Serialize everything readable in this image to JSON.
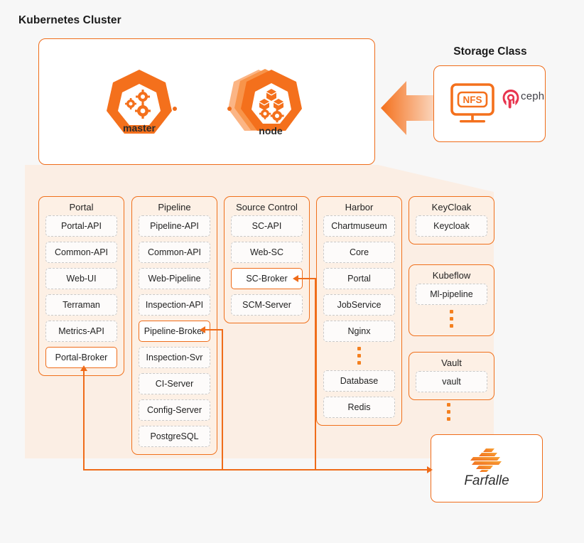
{
  "colors": {
    "accent": "#ef6c1a",
    "accent_light": "#fdf0e5",
    "panel_bg": "#fbeee4",
    "canvas_bg": "#f7f7f7",
    "ceph_pink": "#e8344e",
    "dashed_border": "#c9c9c9"
  },
  "cluster": {
    "title": "Kubernetes Cluster",
    "nodes": [
      {
        "label": "master",
        "icon": "kubernetes-master-icon"
      },
      {
        "label": "node",
        "icon": "kubernetes-node-icon"
      }
    ]
  },
  "storage_class": {
    "title": "Storage Class",
    "items": [
      {
        "label": "NFS",
        "icon": "nfs-monitor-icon"
      },
      {
        "label": "ceph",
        "icon": "ceph-logo-icon"
      }
    ],
    "arrow_icon": "left-arrow-icon"
  },
  "groups": [
    {
      "title": "Portal",
      "services": [
        {
          "label": "Portal-API",
          "highlighted": false
        },
        {
          "label": "Common-API",
          "highlighted": false
        },
        {
          "label": "Web-UI",
          "highlighted": false
        },
        {
          "label": "Terraman",
          "highlighted": false
        },
        {
          "label": "Metrics-API",
          "highlighted": false
        },
        {
          "label": "Portal-Broker",
          "highlighted": true
        }
      ],
      "ellipsis": false
    },
    {
      "title": "Pipeline",
      "services": [
        {
          "label": "Pipeline-API",
          "highlighted": false
        },
        {
          "label": "Common-API",
          "highlighted": false
        },
        {
          "label": "Web-Pipeline",
          "highlighted": false
        },
        {
          "label": "Inspection-API",
          "highlighted": false
        },
        {
          "label": "Pipeline-Broker",
          "highlighted": true
        },
        {
          "label": "Inspection-Svr",
          "highlighted": false
        },
        {
          "label": "CI-Server",
          "highlighted": false
        },
        {
          "label": "Config-Server",
          "highlighted": false
        },
        {
          "label": "PostgreSQL",
          "highlighted": false
        }
      ],
      "ellipsis": false
    },
    {
      "title": "Source Control",
      "services": [
        {
          "label": "SC-API",
          "highlighted": false
        },
        {
          "label": "Web-SC",
          "highlighted": false
        },
        {
          "label": "SC-Broker",
          "highlighted": true
        },
        {
          "label": "SCM-Server",
          "highlighted": false
        }
      ],
      "ellipsis": false
    },
    {
      "title": "Harbor",
      "services": [
        {
          "label": "Chartmuseum",
          "highlighted": false
        },
        {
          "label": "Core",
          "highlighted": false
        },
        {
          "label": "Portal",
          "highlighted": false
        },
        {
          "label": "JobService",
          "highlighted": false
        },
        {
          "label": "Nginx",
          "highlighted": false
        },
        {
          "label": "__ellipsis__",
          "highlighted": false
        },
        {
          "label": "Database",
          "highlighted": false
        },
        {
          "label": "Redis",
          "highlighted": false
        }
      ],
      "ellipsis": false
    },
    {
      "title": "KeyCloak",
      "services": [
        {
          "label": "Keycloak",
          "highlighted": false
        }
      ],
      "ellipsis": false
    },
    {
      "title": "Kubeflow",
      "services": [
        {
          "label": "Ml-pipeline",
          "highlighted": false
        },
        {
          "label": "__ellipsis__",
          "highlighted": false
        }
      ],
      "ellipsis": false
    },
    {
      "title": "Vault",
      "services": [
        {
          "label": "vault",
          "highlighted": false
        }
      ],
      "ellipsis": true
    }
  ],
  "farfalle": {
    "label": "Farfalle",
    "icon": "farfalle-logo-icon"
  }
}
